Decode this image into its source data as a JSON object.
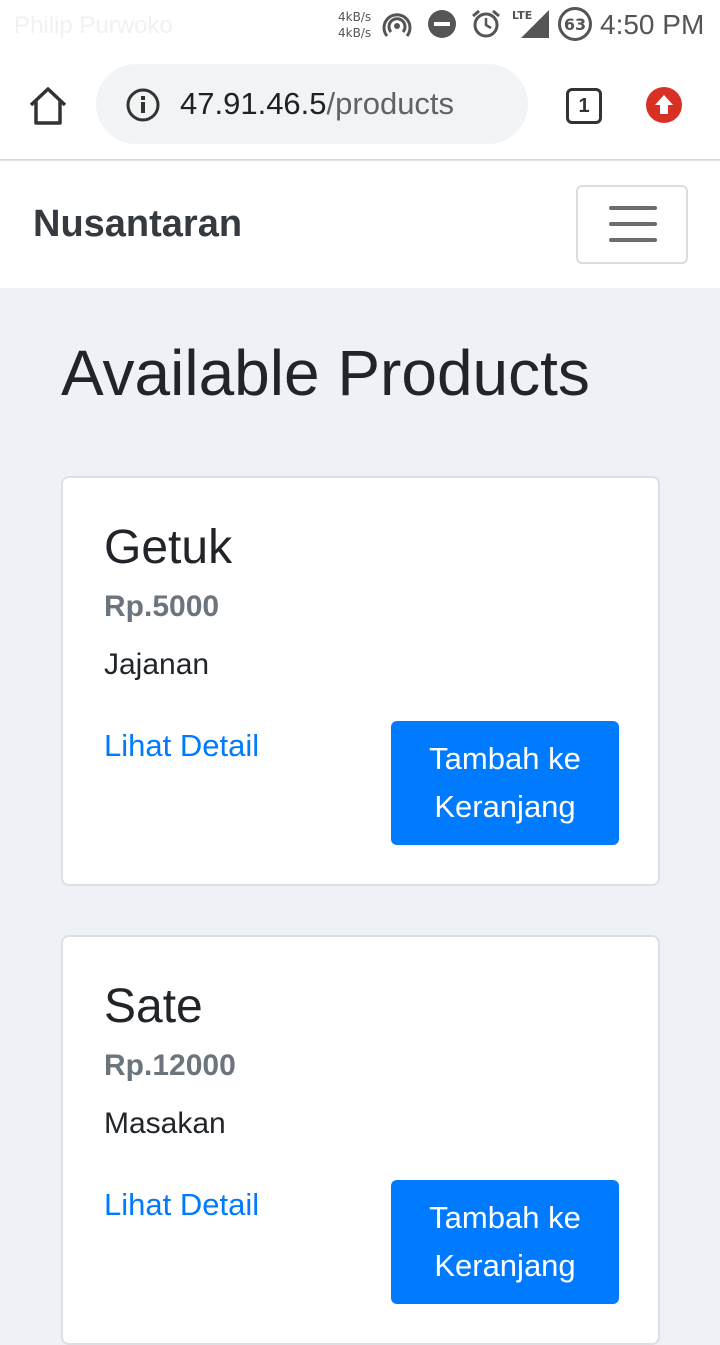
{
  "status_bar": {
    "carrier": "Philip Purwoko",
    "net_up": "4kB/s",
    "net_down": "4kB/s",
    "net_type": "LTE",
    "battery": "63",
    "time": "4:50 PM"
  },
  "browser": {
    "url_host": "47.91.46.5",
    "url_path": "/products",
    "tab_count": "1"
  },
  "navbar": {
    "brand": "Nusantaran"
  },
  "page": {
    "title": "Available Products"
  },
  "products": [
    {
      "name": "Getuk",
      "price": "Rp.5000",
      "category": "Jajanan",
      "detail_label": "Lihat Detail",
      "cart_label": "Tambah ke Keranjang"
    },
    {
      "name": "Sate",
      "price": "Rp.12000",
      "category": "Masakan",
      "detail_label": "Lihat Detail",
      "cart_label": "Tambah ke Keranjang"
    }
  ],
  "colors": {
    "primary": "#007bff",
    "background": "#eef2f6",
    "brand_text": "#343a40",
    "muted": "#6c757d",
    "update_icon": "#d93025"
  },
  "icons": {
    "home": "home-icon",
    "info": "info-icon",
    "tabs": "tabs-icon",
    "update": "update-arrow-icon",
    "menu": "hamburger-menu-icon",
    "hotspot": "hotspot-icon",
    "dnd": "do-not-disturb-icon",
    "alarm": "alarm-icon",
    "signal": "signal-icon"
  }
}
